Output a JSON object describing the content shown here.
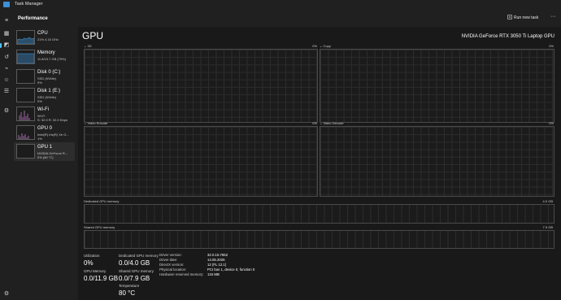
{
  "window": {
    "title": "Task Manager"
  },
  "header": {
    "title": "Performance",
    "run_new_task": "Run new task"
  },
  "sidebar": {
    "devices": [
      {
        "name": "CPU",
        "sub1": "21%  4.15 GHz",
        "sub2": ""
      },
      {
        "name": "Memory",
        "sub1": "11.8/15.7 GB (75%)",
        "sub2": ""
      },
      {
        "name": "Disk 0 (C:)",
        "sub1": "SSD (NVMe)",
        "sub2": "0%"
      },
      {
        "name": "Disk 1 (E:)",
        "sub1": "SSD (NVMe)",
        "sub2": "0%"
      },
      {
        "name": "Wi-Fi",
        "sub1": "Wi-Fi",
        "sub2": "S: 32.0  R: 32.0 Kbps"
      },
      {
        "name": "GPU 0",
        "sub1": "Intel(R) Iris(R) Xe G...",
        "sub2": "1%"
      },
      {
        "name": "GPU 1",
        "sub1": "NVIDIA GeForce R...",
        "sub2": "0% (80 °C)"
      }
    ]
  },
  "gpu": {
    "title": "GPU",
    "model": "NVIDIA GeForce RTX 3050 Ti Laptop GPU",
    "engines": [
      {
        "label": "3D",
        "pct": "0%"
      },
      {
        "label": "Copy",
        "pct": "0%"
      },
      {
        "label": "Video Encode",
        "pct": "0%"
      },
      {
        "label": "Video Decode",
        "pct": "0%"
      }
    ],
    "dedicated": {
      "label": "Dedicated GPU memory",
      "max": "4.0 GB"
    },
    "shared": {
      "label": "Shared GPU memory",
      "max": "7.9 GB"
    },
    "stats": {
      "utilization_label": "Utilization",
      "utilization": "0%",
      "dedicated_label": "Dedicated GPU memory",
      "dedicated": "0.0/4.0 GB",
      "gpu_memory_label": "GPU Memory",
      "gpu_memory": "0.0/11.9 GB",
      "shared_label": "Shared GPU memory",
      "shared": "0.0/7.9 GB",
      "temp_label": "Temperature",
      "temp": "80 °C"
    },
    "info": [
      {
        "key": "Driver version:",
        "value": "32.0.15.7652"
      },
      {
        "key": "Driver date:",
        "value": "14.05.2025"
      },
      {
        "key": "DirectX version:",
        "value": "12 (FL 12.1)"
      },
      {
        "key": "Physical location:",
        "value": "PCI bus 1, device 0, function 0"
      },
      {
        "key": "Hardware reserved memory:",
        "value": "134 MB"
      }
    ]
  },
  "colors": {
    "accent": "#4cc2ff",
    "cpu_graph": "#3f8ec7",
    "wifi_graph": "#c07ec9",
    "gpu_graph": "#8b65c5"
  }
}
